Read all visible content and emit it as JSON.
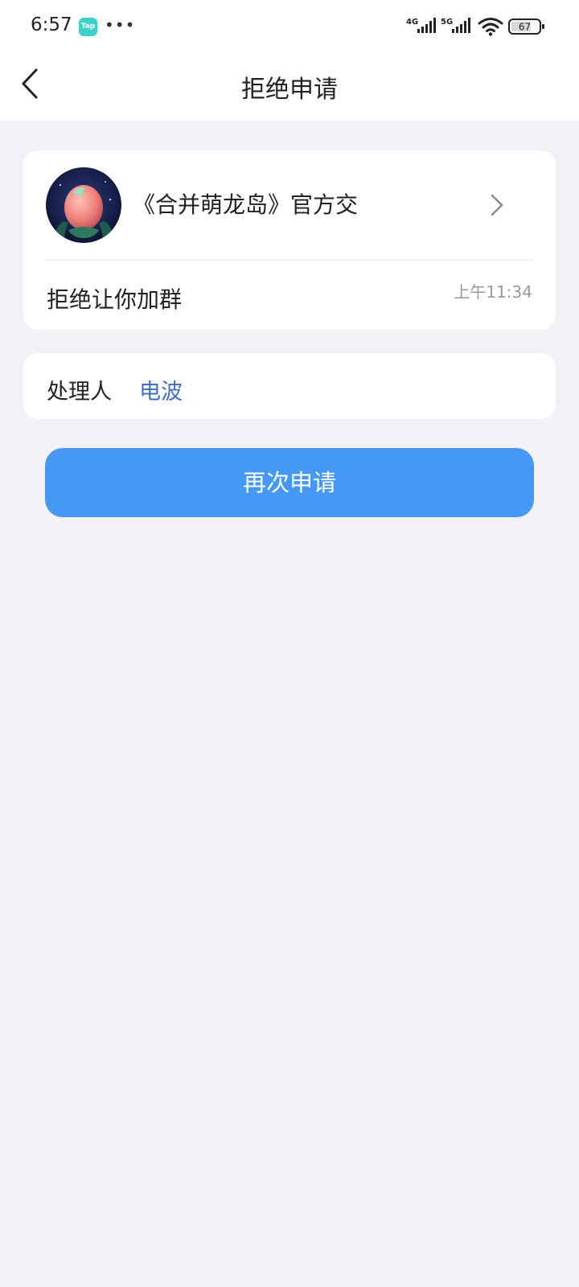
{
  "status_bar": {
    "time": "6:57",
    "app_badge": "Tap",
    "more": "•••",
    "network_1": "4G",
    "network_2": "5G",
    "battery": "67"
  },
  "nav": {
    "title": "拒绝申请"
  },
  "group_card": {
    "group_name": "《合并萌龙岛》官方交",
    "reject_text": "拒绝让你加群",
    "time": "上午11:34"
  },
  "handler": {
    "label": "处理人",
    "name": "电波"
  },
  "actions": {
    "reapply_label": "再次申请"
  },
  "colors": {
    "primary_button": "#4698f7",
    "link": "#3e6fc4",
    "background": "#f1f1f6",
    "tap_badge": "#3fd0c9"
  },
  "icons": [
    "back-icon",
    "chevron-right-icon",
    "wifi-icon",
    "battery-icon",
    "signal-icon"
  ]
}
